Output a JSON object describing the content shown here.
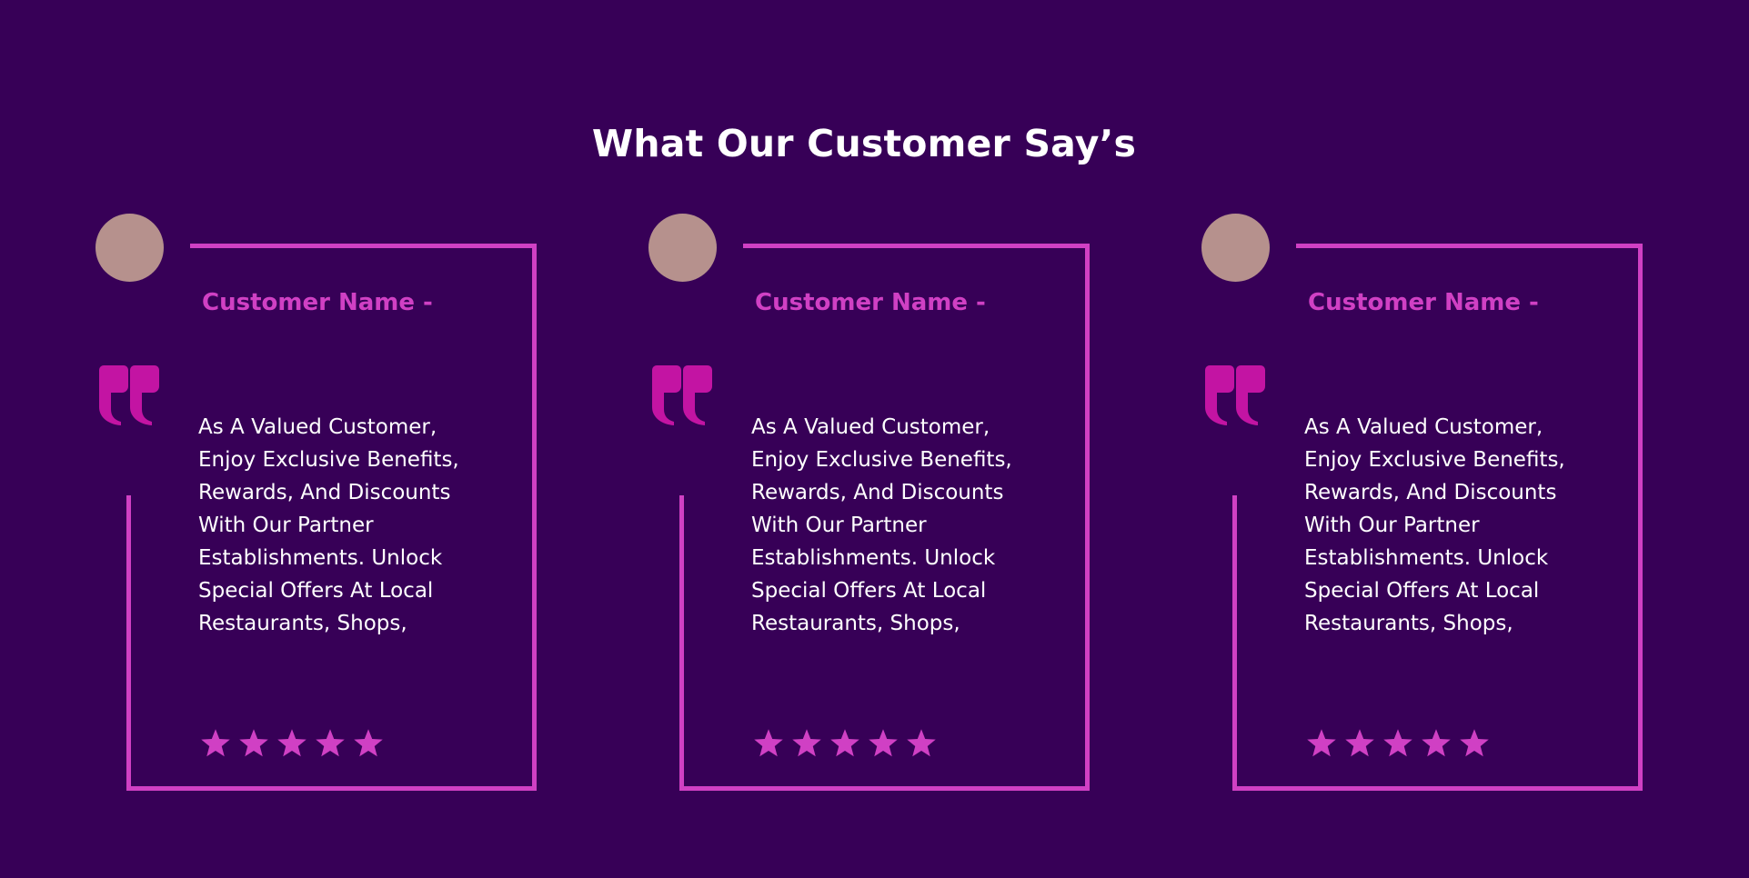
{
  "section": {
    "title": "What Our Customer Say’s"
  },
  "colors": {
    "background": "#370057",
    "accent": "#d040c4",
    "quote": "#c314a3",
    "avatar": "#b6918d",
    "text": "#ffffff"
  },
  "testimonials": [
    {
      "name": "Customer Name -",
      "text": " As A Valued Customer,\nEnjoy Exclusive Benefits,\nRewards, And Discounts\nWith Our Partner\nEstablishments. Unlock\nSpecial Offers At Local\nRestaurants, Shops,",
      "rating": 5,
      "avatar_icon": "avatar-circle",
      "quote_icon": "quote-icon",
      "star_icon": "star-icon"
    },
    {
      "name": "Customer Name -",
      "text": " As A Valued Customer,\nEnjoy Exclusive Benefits,\nRewards, And Discounts\nWith Our Partner\nEstablishments. Unlock\nSpecial Offers At Local\nRestaurants, Shops,",
      "rating": 5,
      "avatar_icon": "avatar-circle",
      "quote_icon": "quote-icon",
      "star_icon": "star-icon"
    },
    {
      "name": "Customer Name -",
      "text": " As A Valued Customer,\nEnjoy Exclusive Benefits,\nRewards, And Discounts\nWith Our Partner\nEstablishments. Unlock\nSpecial Offers At Local\nRestaurants, Shops,",
      "rating": 5,
      "avatar_icon": "avatar-circle",
      "quote_icon": "quote-icon",
      "star_icon": "star-icon"
    }
  ]
}
